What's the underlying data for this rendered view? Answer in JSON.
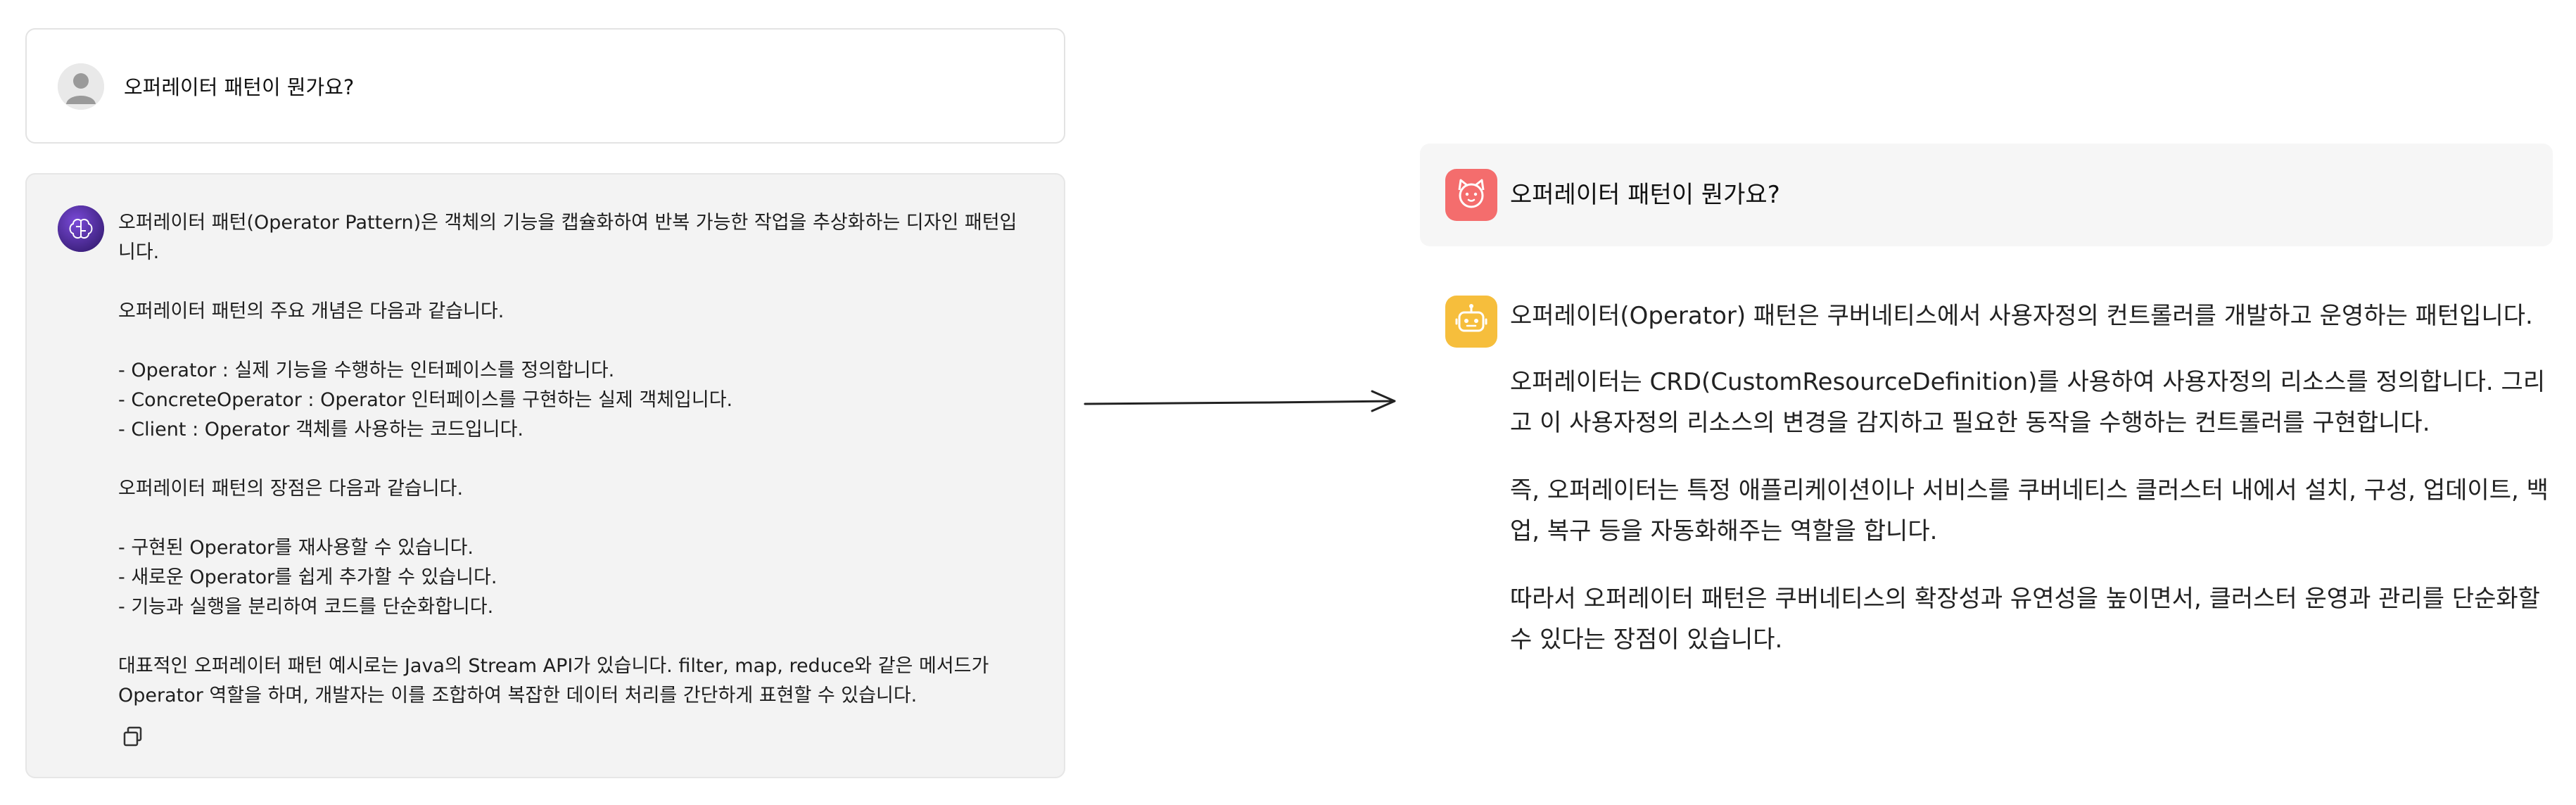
{
  "left_panel": {
    "question": "오퍼레이터 패턴이 뭔가요?",
    "answer_lines": [
      "오퍼레이터 패턴(Operator Pattern)은 객체의 기능을 캡슐화하여 반복 가능한 작업을 추상화하는 디자인 패턴입",
      "니다.",
      "",
      "오퍼레이터 패턴의 주요 개념은 다음과 같습니다.",
      "",
      "- Operator : 실제 기능을 수행하는 인터페이스를 정의합니다.",
      "- ConcreteOperator : Operator 인터페이스를 구현하는 실제 객체입니다.",
      "- Client : Operator 객체를 사용하는 코드입니다.",
      "",
      "오퍼레이터 패턴의 장점은 다음과 같습니다.",
      "",
      "- 구현된 Operator를 재사용할 수 있습니다.",
      "- 새로운 Operator를 쉽게 추가할 수 있습니다.",
      "- 기능과 실행을 분리하여 코드를 단순화합니다.",
      "",
      "대표적인 오퍼레이터 패턴 예시로는 Java의 Stream API가 있습니다. filter, map, reduce와 같은 메서드가",
      "Operator 역할을 하며, 개발자는 이를 조합하여 복잡한 데이터 처리를 간단하게 표현할 수 있습니다."
    ]
  },
  "right_panel": {
    "question": "오퍼레이터 패턴이 뭔가요?",
    "paragraphs": [
      "오퍼레이터(Operator) 패턴은 쿠버네티스에서 사용자정의 컨트롤러를 개발하고 운영하는 패턴입니다.",
      "오퍼레이터는 CRD(CustomResourceDefinition)를 사용하여 사용자정의 리소스를 정의합니다. 그리고 이 사용자정의 리소스의 변경을 감지하고 필요한 동작을 수행하는 컨트롤러를 구현합니다.",
      "즉, 오퍼레이터는 특정 애플리케이션이나 서비스를 쿠버네티스 클러스터 내에서 설치, 구성, 업데이트, 백업, 복구 등을 자동화해주는 역할을 합니다.",
      "따라서 오퍼레이터 패턴은 쿠버네티스의 확장성과 유연성을 높이면서, 클러스터 운영과 관리를 단순화할 수 있다는 장점이 있습니다."
    ]
  },
  "icons": {
    "user": "user-avatar-icon",
    "brain": "brain-avatar-icon",
    "copy": "copy-icon",
    "arrow": "arrow-right-icon",
    "cat": "cat-avatar-icon",
    "bot": "bot-avatar-icon"
  },
  "colors": {
    "left_answer_bg": "#f3f3f3",
    "brain_avatar": "#4b2a93",
    "cat_avatar": "#f46d6d",
    "bot_avatar": "#f6be3c"
  }
}
